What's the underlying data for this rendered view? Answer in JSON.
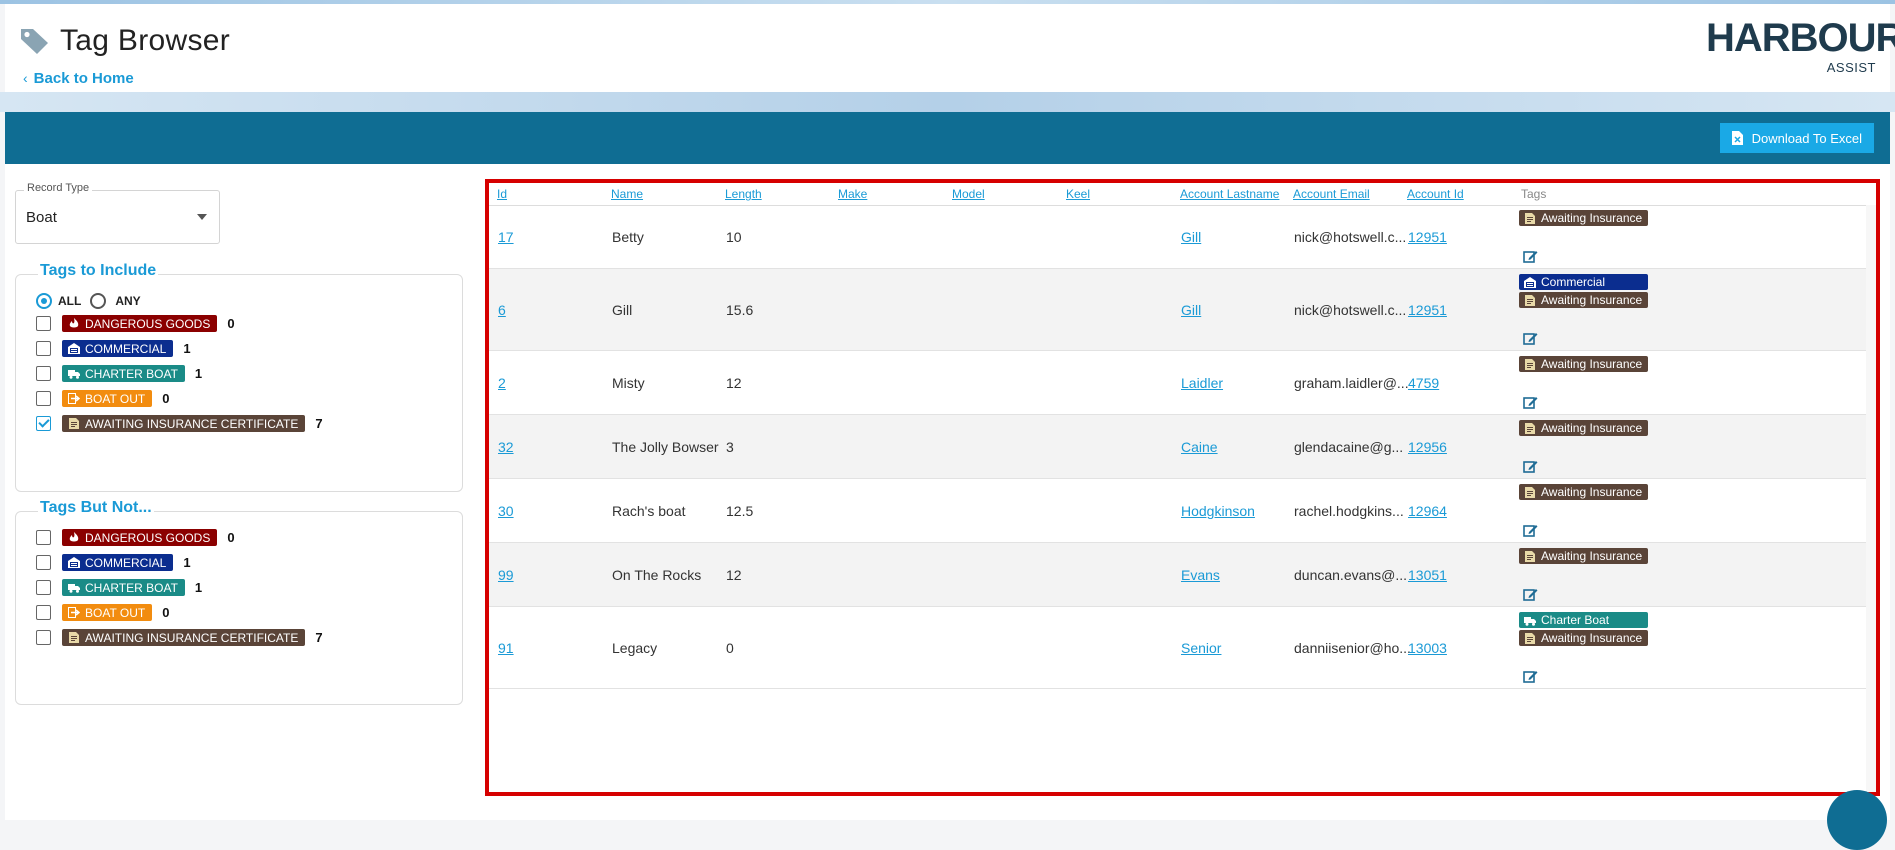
{
  "header": {
    "title": "Tag Browser",
    "back_label": "Back to Home",
    "back_chevron": "‹",
    "logo_text": "HARBOUR",
    "logo_sub": "ASSIST"
  },
  "toolbar": {
    "download_label": "Download To Excel"
  },
  "filters": {
    "record_type_label": "Record Type",
    "record_type_value": "Boat",
    "include_legend": "Tags to Include",
    "exclude_legend": "Tags But Not...",
    "mode_all": "ALL",
    "mode_any": "ANY",
    "mode_selected": "ALL",
    "include_tags": [
      {
        "label": "DANGEROUS GOODS",
        "count": "0",
        "checked": false,
        "color": "#8b0000",
        "icon": "flame-icon"
      },
      {
        "label": "COMMERCIAL",
        "count": "1",
        "checked": false,
        "color": "#0b2d8f",
        "icon": "building-icon"
      },
      {
        "label": "CHARTER BOAT",
        "count": "1",
        "checked": false,
        "color": "#1a8b87",
        "icon": "truck-icon"
      },
      {
        "label": "BOAT OUT",
        "count": "0",
        "checked": false,
        "color": "#f28c0f",
        "icon": "exit-icon"
      },
      {
        "label": "AWAITING INSURANCE CERTIFICATE",
        "count": "7",
        "checked": true,
        "color": "#5a4438",
        "icon": "document-icon"
      }
    ],
    "exclude_tags": [
      {
        "label": "DANGEROUS GOODS",
        "count": "0",
        "checked": false,
        "color": "#8b0000",
        "icon": "flame-icon"
      },
      {
        "label": "COMMERCIAL",
        "count": "1",
        "checked": false,
        "color": "#0b2d8f",
        "icon": "building-icon"
      },
      {
        "label": "CHARTER BOAT",
        "count": "1",
        "checked": false,
        "color": "#1a8b87",
        "icon": "truck-icon"
      },
      {
        "label": "BOAT OUT",
        "count": "0",
        "checked": false,
        "color": "#f28c0f",
        "icon": "exit-icon"
      },
      {
        "label": "AWAITING INSURANCE CERTIFICATE",
        "count": "7",
        "checked": false,
        "color": "#5a4438",
        "icon": "document-icon"
      }
    ]
  },
  "table": {
    "columns": [
      "Id",
      "Name",
      "Length",
      "Make",
      "Model",
      "Keel",
      "Account Lastname",
      "Account Email",
      "Account Id",
      "Tags"
    ],
    "rows": [
      {
        "id": "17",
        "name": "Betty",
        "length": "10",
        "make": "",
        "model": "",
        "keel": "",
        "lastname": "Gill",
        "email": "nick@hotswell.c...",
        "account_id": "12951",
        "tags": [
          {
            "label": "Awaiting Insurance",
            "color": "#5a4438",
            "icon": "document-icon"
          }
        ]
      },
      {
        "id": "6",
        "name": "Gill",
        "length": "15.6",
        "make": "",
        "model": "",
        "keel": "",
        "lastname": "Gill",
        "email": "nick@hotswell.c...",
        "account_id": "12951",
        "tags": [
          {
            "label": "Commercial",
            "color": "#0b2d8f",
            "icon": "building-icon"
          },
          {
            "label": "Awaiting Insurance",
            "color": "#5a4438",
            "icon": "document-icon"
          }
        ]
      },
      {
        "id": "2",
        "name": "Misty",
        "length": "12",
        "make": "",
        "model": "",
        "keel": "",
        "lastname": "Laidler",
        "email": "graham.laidler@...",
        "account_id": "4759",
        "tags": [
          {
            "label": "Awaiting Insurance",
            "color": "#5a4438",
            "icon": "document-icon"
          }
        ]
      },
      {
        "id": "32",
        "name": "The Jolly Bowser",
        "length": "3",
        "make": "",
        "model": "",
        "keel": "",
        "lastname": "Caine",
        "email": "glendacaine@g...",
        "account_id": "12956",
        "tags": [
          {
            "label": "Awaiting Insurance",
            "color": "#5a4438",
            "icon": "document-icon"
          }
        ]
      },
      {
        "id": "30",
        "name": "Rach's boat",
        "length": "12.5",
        "make": "",
        "model": "",
        "keel": "",
        "lastname": "Hodgkinson",
        "email": "rachel.hodgkins...",
        "account_id": "12964",
        "tags": [
          {
            "label": "Awaiting Insurance",
            "color": "#5a4438",
            "icon": "document-icon"
          }
        ]
      },
      {
        "id": "99",
        "name": "On The Rocks",
        "length": "12",
        "make": "",
        "model": "",
        "keel": "",
        "lastname": "Evans",
        "email": "duncan.evans@...",
        "account_id": "13051",
        "tags": [
          {
            "label": "Awaiting Insurance",
            "color": "#5a4438",
            "icon": "document-icon"
          }
        ]
      },
      {
        "id": "91",
        "name": "Legacy",
        "length": "0",
        "make": "",
        "model": "",
        "keel": "",
        "lastname": "Senior",
        "email": "danniisenior@ho...",
        "account_id": "13003",
        "tags": [
          {
            "label": "Charter Boat",
            "color": "#1a8b87",
            "icon": "truck-icon"
          },
          {
            "label": "Awaiting Insurance",
            "color": "#5a4438",
            "icon": "document-icon"
          }
        ]
      }
    ]
  },
  "colors": {
    "accent": "#1a9ad6",
    "toolbar": "#0f6d93",
    "highlight": "#d60000"
  }
}
